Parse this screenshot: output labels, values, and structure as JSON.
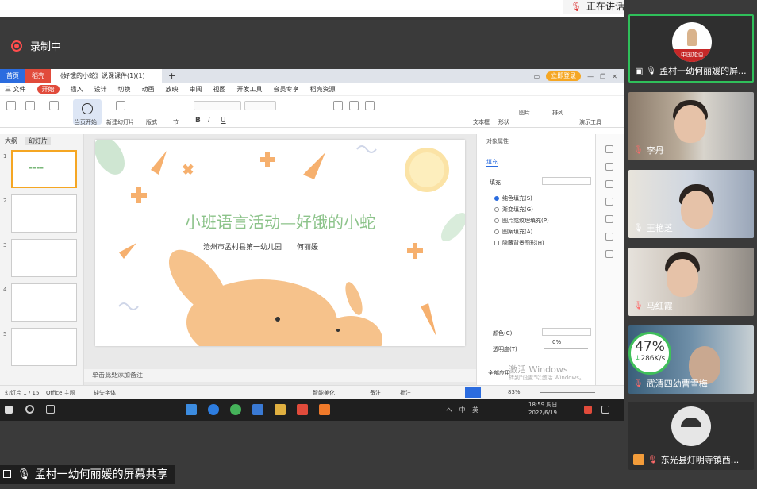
{
  "speaking": {
    "text": "正在讲话: 孟村一幼何丽媛;"
  },
  "recording": {
    "label": "录制中"
  },
  "wps": {
    "tabs": [
      {
        "label": "首页"
      },
      {
        "label": "稻壳"
      },
      {
        "label": "《好饿的小蛇》说课课件(1)(1)"
      },
      {
        "label": "+"
      }
    ],
    "login": "立即登录",
    "menu": [
      "三 文件",
      "开始",
      "插入",
      "设计",
      "切换",
      "动画",
      "放映",
      "审阅",
      "视图",
      "开发工具",
      "会员专享",
      "稻壳资源"
    ],
    "ribbon": {
      "play_label": "当页开始",
      "new_slide": "新建幻灯片",
      "layout": "版式",
      "section": "节",
      "textbox": "文本框",
      "shape": "形状",
      "picture": "图片",
      "arrange": "排列",
      "present_tools": "演示工具"
    },
    "left": {
      "tab1": "大纲",
      "tab2": "幻灯片",
      "thumbs": [
        "1",
        "2",
        "3",
        "4",
        "5"
      ]
    },
    "slide": {
      "title": "小班语言活动—好饿的小蛇",
      "subtitle": "沧州市孟村县第一幼儿园",
      "author": "何丽媛"
    },
    "notes": "单击此处添加备注",
    "right": {
      "title": "对象属性",
      "tab": "填充",
      "section": "填充",
      "options": [
        {
          "label": "纯色填充(S)",
          "selected": true
        },
        {
          "label": "渐变填充(G)",
          "selected": false
        },
        {
          "label": "图片或纹理填充(P)",
          "selected": false
        },
        {
          "label": "图案填充(A)",
          "selected": false
        },
        {
          "label": "隐藏背景图形(H)",
          "selected": false
        }
      ],
      "color_label": "颜色(C)",
      "transparency_label": "透明度(T)",
      "transparency_value": "0%",
      "apply_all": "全部应用",
      "watermark": "激活 Windows",
      "watermark_sub": "转到\"设置\"以激活 Windows。"
    },
    "status": {
      "page": "幻灯片 1 / 15",
      "theme": "Office 主题",
      "missing_font": "缺失字体",
      "beautify": "智能美化",
      "notes": "备注",
      "comment": "批注",
      "zoom": "83%"
    }
  },
  "taskbar": {
    "time": "18:59 周日",
    "date": "2022/6/19",
    "tray": "へ 中 英"
  },
  "share_label": "孟村一幼何丽媛的屏幕共享",
  "participants": [
    {
      "name": "孟村一幼何丽媛的屏...",
      "mic": "on",
      "avatar_text": "中国加油"
    },
    {
      "name": "李丹",
      "mic": "off"
    },
    {
      "name": "王艳芝",
      "mic": "on"
    },
    {
      "name": "马红霞",
      "mic": "off"
    },
    {
      "name": "武清四幼曹雪梅",
      "mic": "off"
    },
    {
      "name": "东光县灯明寺镇西...",
      "mic": "off"
    }
  ],
  "network": {
    "percent": "47%",
    "speed": "286K/s"
  },
  "colors": {
    "wps_blue": "#2b6cdf",
    "wps_red": "#e14b3b",
    "slide_green": "#8cc38a",
    "rabbit": "#f6c28b",
    "active_speaker": "#2fbf5a"
  }
}
